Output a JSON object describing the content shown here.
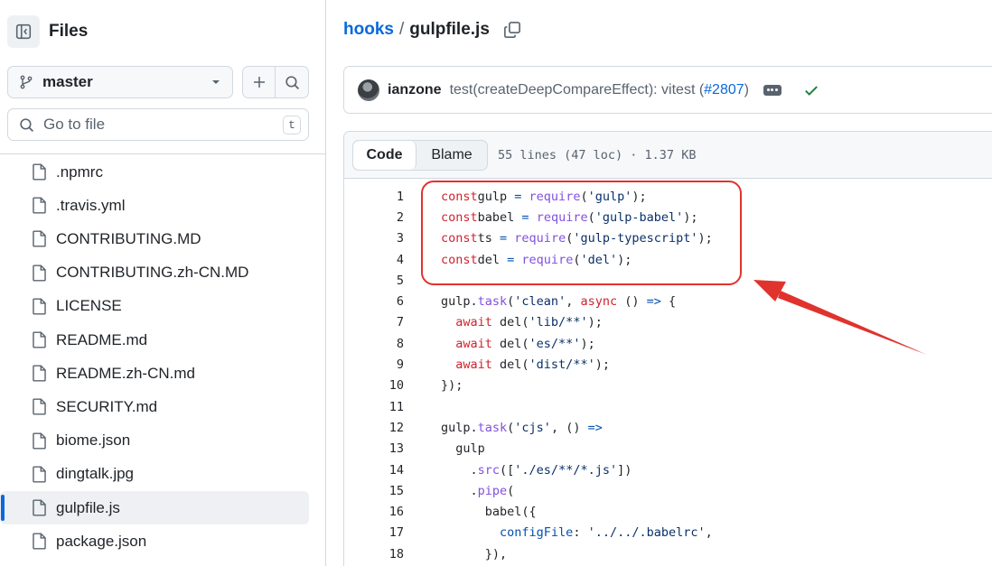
{
  "sidebar": {
    "title": "Files",
    "branch": "master",
    "search_placeholder": "Go to file",
    "search_shortcut": "t",
    "files": [
      ".npmrc",
      ".travis.yml",
      "CONTRIBUTING.MD",
      "CONTRIBUTING.zh-CN.MD",
      "LICENSE",
      "README.md",
      "README.zh-CN.md",
      "SECURITY.md",
      "biome.json",
      "dingtalk.jpg",
      "gulpfile.js",
      "package.json"
    ],
    "active_file": "gulpfile.js"
  },
  "breadcrumb": {
    "repo": "hooks",
    "separator": "/",
    "file": "gulpfile.js"
  },
  "commit": {
    "author": "ianzone",
    "message": "test(createDeepCompareEffect): vitest (",
    "pr_link": "#2807",
    "message_end": ")"
  },
  "code_view": {
    "tab_code": "Code",
    "tab_blame": "Blame",
    "meta": "55 lines (47 loc) · 1.37 KB",
    "lines": [
      [
        [
          "kw",
          "const"
        ],
        [
          "",
          "gulp "
        ],
        [
          "op",
          "="
        ],
        [
          "",
          ""
        ],
        [
          "fn",
          " require"
        ],
        [
          "",
          "("
        ],
        [
          "str",
          "'gulp'"
        ],
        [
          "",
          ");"
        ]
      ],
      [
        [
          "kw",
          "const"
        ],
        [
          "",
          "babel "
        ],
        [
          "op",
          "="
        ],
        [
          "fn",
          " require"
        ],
        [
          "",
          "("
        ],
        [
          "str",
          "'gulp-babel'"
        ],
        [
          "",
          ");"
        ]
      ],
      [
        [
          "kw",
          "const"
        ],
        [
          "",
          "ts "
        ],
        [
          "op",
          "="
        ],
        [
          "fn",
          " require"
        ],
        [
          "",
          "("
        ],
        [
          "str",
          "'gulp-typescript'"
        ],
        [
          "",
          ");"
        ]
      ],
      [
        [
          "kw",
          "const"
        ],
        [
          "",
          "del "
        ],
        [
          "op",
          "="
        ],
        [
          "fn",
          " require"
        ],
        [
          "",
          "("
        ],
        [
          "str",
          "'del'"
        ],
        [
          "",
          ");"
        ]
      ],
      [],
      [
        [
          "",
          "gulp."
        ],
        [
          "fn",
          "task"
        ],
        [
          "",
          "("
        ],
        [
          "str",
          "'clean'"
        ],
        [
          "",
          ", "
        ],
        [
          "kw",
          "async"
        ],
        [
          "",
          " () "
        ],
        [
          "op",
          "=>"
        ],
        [
          "",
          " {"
        ]
      ],
      [
        [
          "",
          "  "
        ],
        [
          "kw",
          "await"
        ],
        [
          "",
          " del("
        ],
        [
          "str",
          "'lib/**'"
        ],
        [
          "",
          ");"
        ]
      ],
      [
        [
          "",
          "  "
        ],
        [
          "kw",
          "await"
        ],
        [
          "",
          " del("
        ],
        [
          "str",
          "'es/**'"
        ],
        [
          "",
          ");"
        ]
      ],
      [
        [
          "",
          "  "
        ],
        [
          "kw",
          "await"
        ],
        [
          "",
          " del("
        ],
        [
          "str",
          "'dist/**'"
        ],
        [
          "",
          ");"
        ]
      ],
      [
        [
          "",
          "});"
        ]
      ],
      [],
      [
        [
          "",
          "gulp."
        ],
        [
          "fn",
          "task"
        ],
        [
          "",
          "("
        ],
        [
          "str",
          "'cjs'"
        ],
        [
          "",
          ", () "
        ],
        [
          "op",
          "=>"
        ]
      ],
      [
        [
          "",
          "  gulp"
        ]
      ],
      [
        [
          "",
          "    ."
        ],
        [
          "fn",
          "src"
        ],
        [
          "",
          "(["
        ],
        [
          "str",
          "'./es/**/*.js'"
        ],
        [
          "",
          "])"
        ]
      ],
      [
        [
          "",
          "    ."
        ],
        [
          "fn",
          "pipe"
        ],
        [
          "",
          "("
        ]
      ],
      [
        [
          "",
          "      babel({"
        ]
      ],
      [
        [
          "",
          "        "
        ],
        [
          "prop",
          "configFile"
        ],
        [
          "",
          ": "
        ],
        [
          "str",
          "'../../.babelrc'"
        ],
        [
          "",
          ","
        ]
      ],
      [
        [
          "",
          "      }),"
        ]
      ]
    ]
  },
  "colors": {
    "accent": "#0969da",
    "annotation": "#e0332d",
    "success": "#1a7f37"
  },
  "icons": {
    "panel": "sidebar-collapse-icon",
    "branch": "git-branch-icon",
    "add": "plus-icon",
    "search": "search-icon",
    "file": "file-icon",
    "copy": "copy-icon",
    "more": "ellipsis-icon",
    "status": "check-icon"
  }
}
